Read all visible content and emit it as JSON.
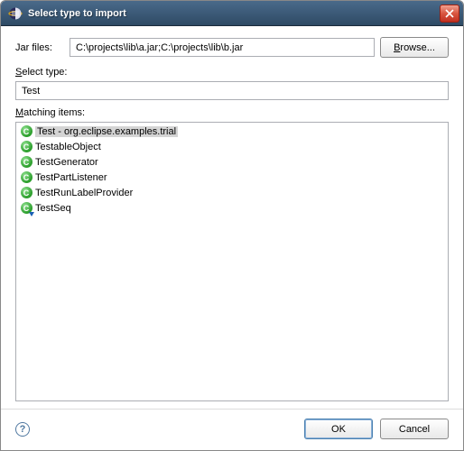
{
  "titlebar": {
    "title": "Select type to import"
  },
  "jar": {
    "label": "Jar files:",
    "value": "C:\\projects\\lib\\a.jar;C:\\projects\\lib\\b.jar",
    "browse": "Browse..."
  },
  "select_type": {
    "label": "Select type:",
    "value": "Test"
  },
  "matching": {
    "label": "Matching items:",
    "items": [
      {
        "text": "Test - org.eclipse.examples.trial",
        "selected": true,
        "overlay": false
      },
      {
        "text": "TestableObject",
        "selected": false,
        "overlay": false
      },
      {
        "text": "TestGenerator",
        "selected": false,
        "overlay": false
      },
      {
        "text": "TestPartListener",
        "selected": false,
        "overlay": false
      },
      {
        "text": "TestRunLabelProvider",
        "selected": false,
        "overlay": false
      },
      {
        "text": "TestSeq",
        "selected": false,
        "overlay": true
      }
    ]
  },
  "buttons": {
    "ok": "OK",
    "cancel": "Cancel"
  },
  "icons": {
    "app": "eclipse-icon",
    "close": "close-icon",
    "help": "help-icon",
    "class": "class-c-icon"
  }
}
